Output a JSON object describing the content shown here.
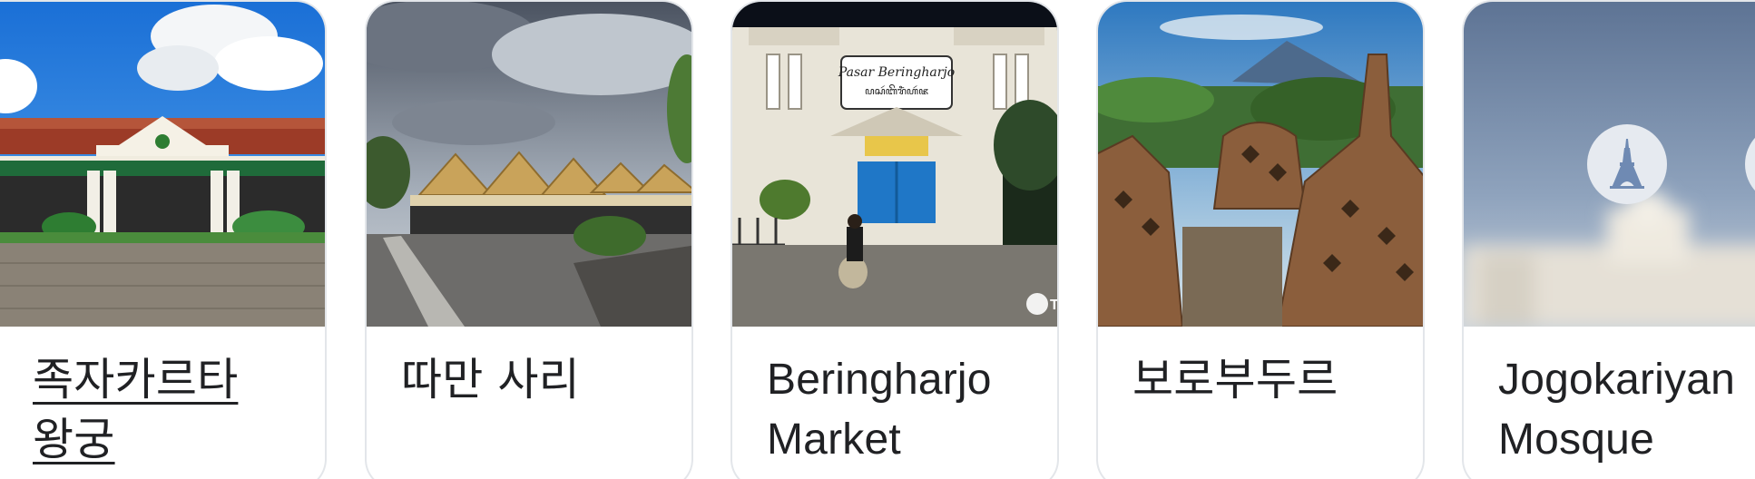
{
  "attractions": [
    {
      "name": "족자카르타 왕궁",
      "line1": "족자카르타",
      "line2": "왕궁"
    },
    {
      "name": "따만 사리"
    },
    {
      "name": "Beringharjo Market",
      "line1": "Beringharjo",
      "line2": "Market",
      "sign_line1": "Pasar Beringharjo",
      "sign_line2": "ꦥꦱꦂꦧꦼꦫꦶꦁꦲꦂꦗ",
      "watermark": "Tri"
    },
    {
      "name": "보로부두르"
    },
    {
      "name": "Jogokariyan Mosque",
      "line1": "Jogokariyan",
      "line2": "Mosque",
      "placeholder_icon": "eiffel-tower-icon"
    }
  ],
  "colors": {
    "title_text": "#202124",
    "card_border": "#e3e6ea",
    "placeholder_bg": "#7f92ad"
  }
}
